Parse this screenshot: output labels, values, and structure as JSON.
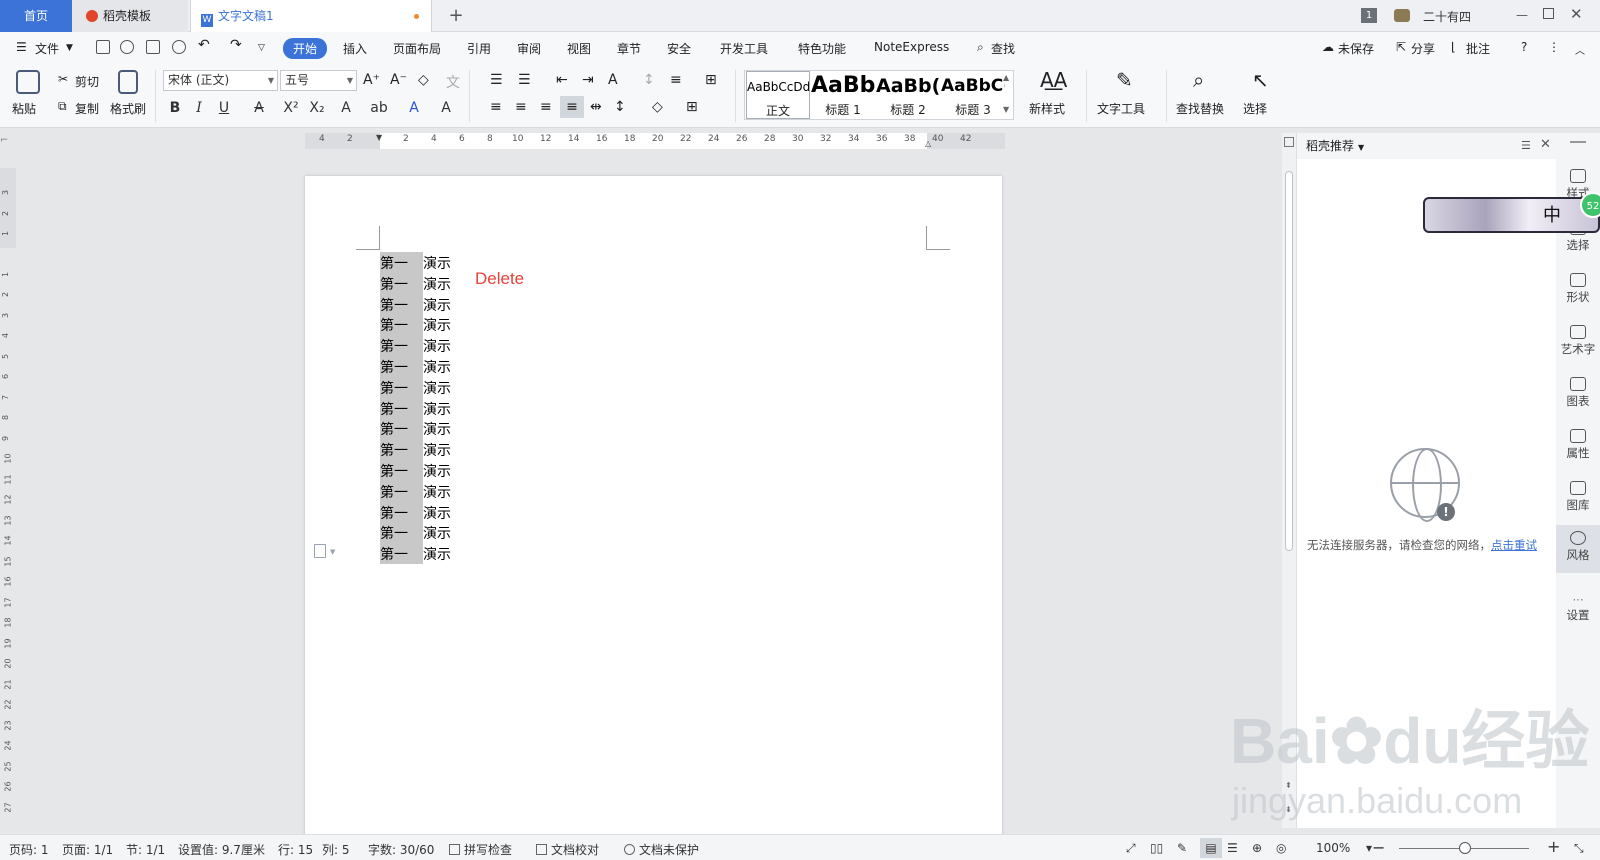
{
  "tabs": {
    "home": "首页",
    "template": "稻壳模板",
    "document": "文字文稿1",
    "new_tab": "+"
  },
  "titlebar": {
    "window_count": "1",
    "user": "二十有四"
  },
  "menu": {
    "file": "文件",
    "items": [
      "开始",
      "插入",
      "页面布局",
      "引用",
      "审阅",
      "视图",
      "章节",
      "安全",
      "开发工具",
      "特色功能",
      "NoteExpress"
    ],
    "search": "查找",
    "unsaved": "未保存",
    "share": "分享",
    "comment": "批注"
  },
  "ribbon": {
    "paste": "粘贴",
    "cut": "剪切",
    "copy": "复制",
    "format_painter": "格式刷",
    "font_name": "宋体 (正文)",
    "font_size": "五号",
    "styles": [
      {
        "preview": "AaBbCcDd",
        "caption": "正文"
      },
      {
        "preview": "AaBb",
        "caption": "标题 1"
      },
      {
        "preview": "AaBb(",
        "caption": "标题 2"
      },
      {
        "preview": "AaBbC(",
        "caption": "标题 3"
      }
    ],
    "new_style": "新样式",
    "text_tools": "文字工具",
    "find_replace": "查找替换",
    "select": "选择"
  },
  "ruler": {
    "top_ticks": [
      "4",
      "2",
      "2",
      "4",
      "6",
      "8",
      "10",
      "12",
      "14",
      "16",
      "18",
      "20",
      "22",
      "24",
      "26",
      "28",
      "30",
      "32",
      "34",
      "36",
      "38",
      "40",
      "42"
    ],
    "left_ticks_upper": [
      "3",
      "2",
      "1"
    ],
    "left_ticks": [
      "1",
      "2",
      "3",
      "4",
      "5",
      "6",
      "7",
      "8",
      "9",
      "10",
      "11",
      "12",
      "13",
      "14",
      "15",
      "16",
      "17",
      "18",
      "19",
      "20",
      "21",
      "22",
      "23",
      "24",
      "25",
      "26",
      "27"
    ]
  },
  "document": {
    "rows": [
      [
        "第一",
        "演示"
      ],
      [
        "第一",
        "演示"
      ],
      [
        "第一",
        "演示"
      ],
      [
        "第一",
        "演示"
      ],
      [
        "第一",
        "演示"
      ],
      [
        "第一",
        "演示"
      ],
      [
        "第一",
        "演示"
      ],
      [
        "第一",
        "演示"
      ],
      [
        "第一",
        "演示"
      ],
      [
        "第一",
        "演示"
      ],
      [
        "第一",
        "演示"
      ],
      [
        "第一",
        "演示"
      ],
      [
        "第一",
        "演示"
      ],
      [
        "第一",
        "演示"
      ],
      [
        "第一",
        "演示"
      ]
    ],
    "annotation": "Delete"
  },
  "side_panel": {
    "title": "稻壳推荐",
    "error_text": "无法连接服务器，请检查您的网络，",
    "retry_link": "点击重试"
  },
  "side_bar": {
    "items": [
      "样式",
      "选择",
      "形状",
      "艺术字",
      "图表",
      "属性",
      "图库",
      "风格",
      "设置"
    ],
    "ime": "中",
    "badge": "52"
  },
  "status": {
    "page_num": "页码: 1",
    "pages": "页面: 1/1",
    "section": "节: 1/1",
    "setting": "设置值: 9.7厘米",
    "row": "行: 15",
    "col": "列: 5",
    "words": "字数: 30/60",
    "spell": "拼写检查",
    "proof": "文档校对",
    "protect": "文档未保护",
    "zoom": "100%"
  },
  "watermark": {
    "brand": "Bai",
    "brand2": "du",
    "brand_cn": "经验",
    "url": "jingyan.baidu.com"
  },
  "colors": {
    "accent": "#3b73d8",
    "delete_note": "#e8423a",
    "selection": "#c8c8c8"
  }
}
